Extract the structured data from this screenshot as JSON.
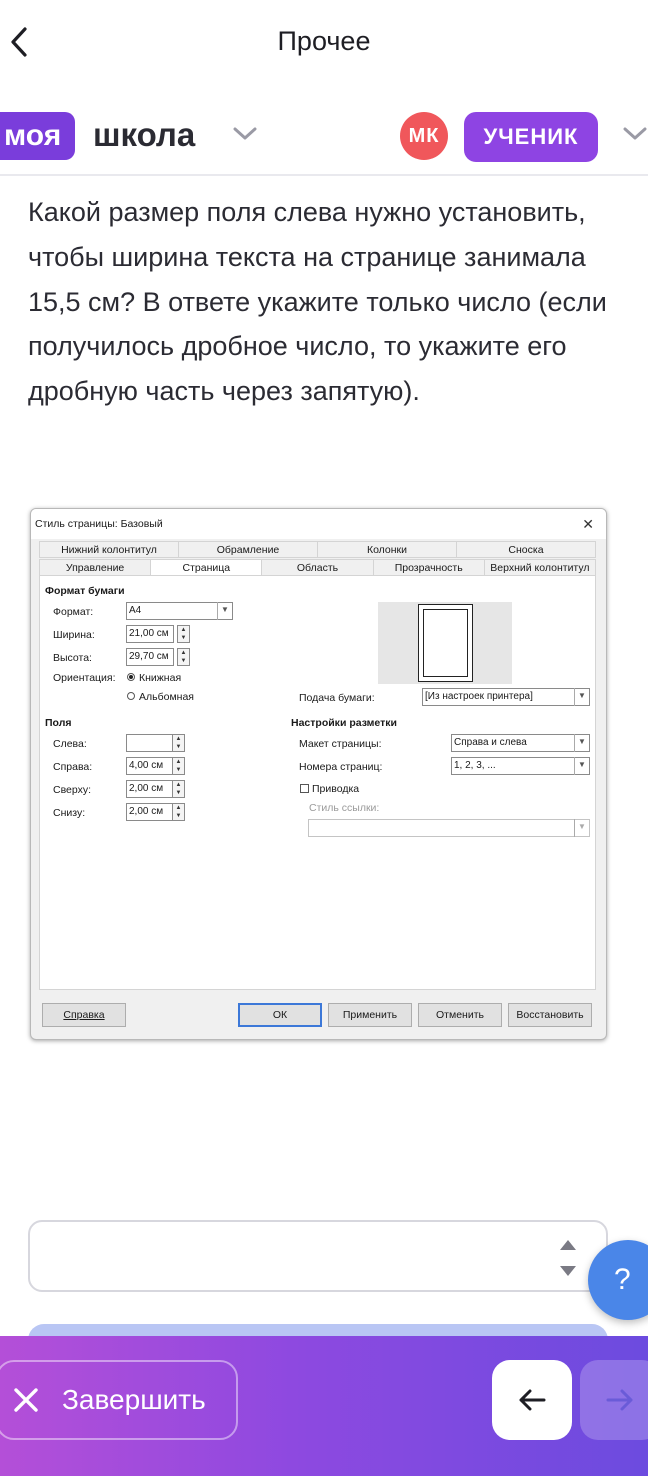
{
  "header": {
    "title": "Прочее"
  },
  "brand": {
    "logo_part1": "моя",
    "logo_part2": "школа",
    "avatar_initials": "МК",
    "role_label": "УЧЕНИК"
  },
  "question": {
    "text": "Какой размер поля слева нужно установить, чтобы ширина текста на странице занимала 15,5 см? В ответе укажите только число (если получилось дробное число, то укажите его дробную часть через запятую)."
  },
  "dialog": {
    "title": "Стиль страницы: Базовый",
    "tabs_row1": [
      "Нижний колонтитул",
      "Обрамление",
      "Колонки",
      "Сноска"
    ],
    "tabs_row2": [
      "Управление",
      "Страница",
      "Область",
      "Прозрачность",
      "Верхний колонтитул"
    ],
    "active_tab": "Страница",
    "paper_format": {
      "heading": "Формат бумаги",
      "format_label": "Формат:",
      "format_value": "A4",
      "width_label": "Ширина:",
      "width_value": "21,00 см",
      "height_label": "Высота:",
      "height_value": "29,70 см",
      "orientation_label": "Ориентация:",
      "orientation_portrait": "Книжная",
      "orientation_landscape": "Альбомная"
    },
    "paper_tray": {
      "label": "Подача бумаги:",
      "value": "[Из настроек принтера]"
    },
    "margins": {
      "heading": "Поля",
      "left_label": "Слева:",
      "left_value": "",
      "right_label": "Справа:",
      "right_value": "4,00 см",
      "top_label": "Сверху:",
      "top_value": "2,00 см",
      "bottom_label": "Снизу:",
      "bottom_value": "2,00 см"
    },
    "layout_settings": {
      "heading": "Настройки разметки",
      "page_layout_label": "Макет страницы:",
      "page_layout_value": "Справа и слева",
      "page_numbers_label": "Номера страниц:",
      "page_numbers_value": "1, 2, 3, ...",
      "register_true_label": "Приводка",
      "reference_style_label": "Стиль ссылки:"
    },
    "buttons": {
      "help": "Справка",
      "ok": "ОК",
      "apply": "Применить",
      "cancel": "Отменить",
      "reset": "Восстановить"
    }
  },
  "answer": {
    "value": ""
  },
  "help_button": {
    "label": "?"
  },
  "footer": {
    "finish_label": "Завершить"
  },
  "colors": {
    "accent": "#8e44e3",
    "avatar": "#f0575b",
    "help": "#4a86e8",
    "bar_start": "#b44fd8",
    "bar_end": "#6c4bdf"
  }
}
